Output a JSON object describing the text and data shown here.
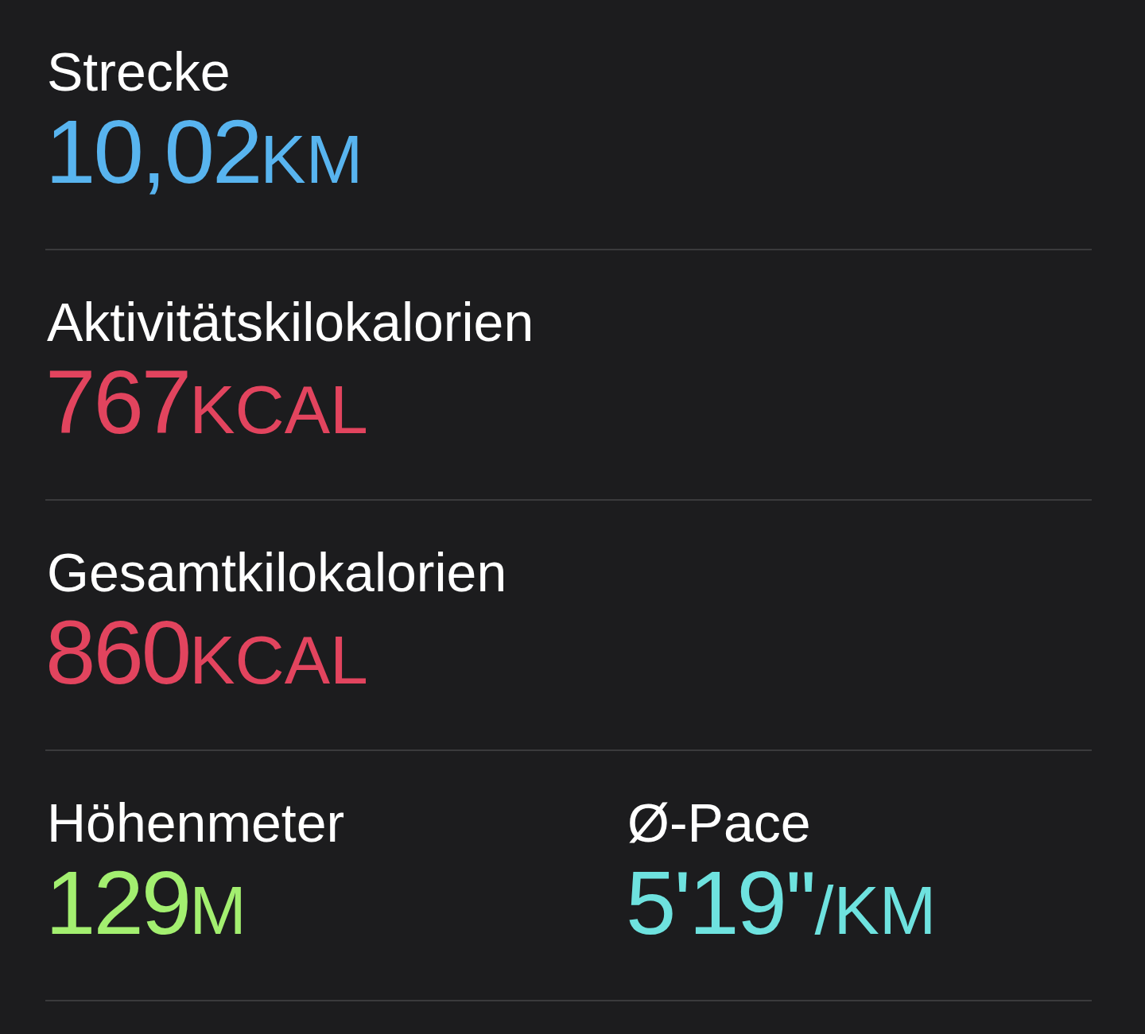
{
  "rows": [
    {
      "metrics": [
        {
          "label": "Strecke",
          "value": "10,02",
          "unit": "KM",
          "color": "#58b4ef"
        }
      ]
    },
    {
      "metrics": [
        {
          "label": "Aktivitätskilokalorien",
          "value": "767",
          "unit": "KCAL",
          "color": "#e2445e"
        }
      ]
    },
    {
      "metrics": [
        {
          "label": "Gesamtkilokalorien",
          "value": "860",
          "unit": "KCAL",
          "color": "#e2445e"
        }
      ]
    },
    {
      "metrics": [
        {
          "label": "Höhenmeter",
          "value": "129",
          "unit": "M",
          "color": "#a3ef70"
        },
        {
          "label": "Ø-Pace",
          "value": "5'19''",
          "unit": "/KM",
          "color": "#6ee2df"
        }
      ]
    }
  ]
}
